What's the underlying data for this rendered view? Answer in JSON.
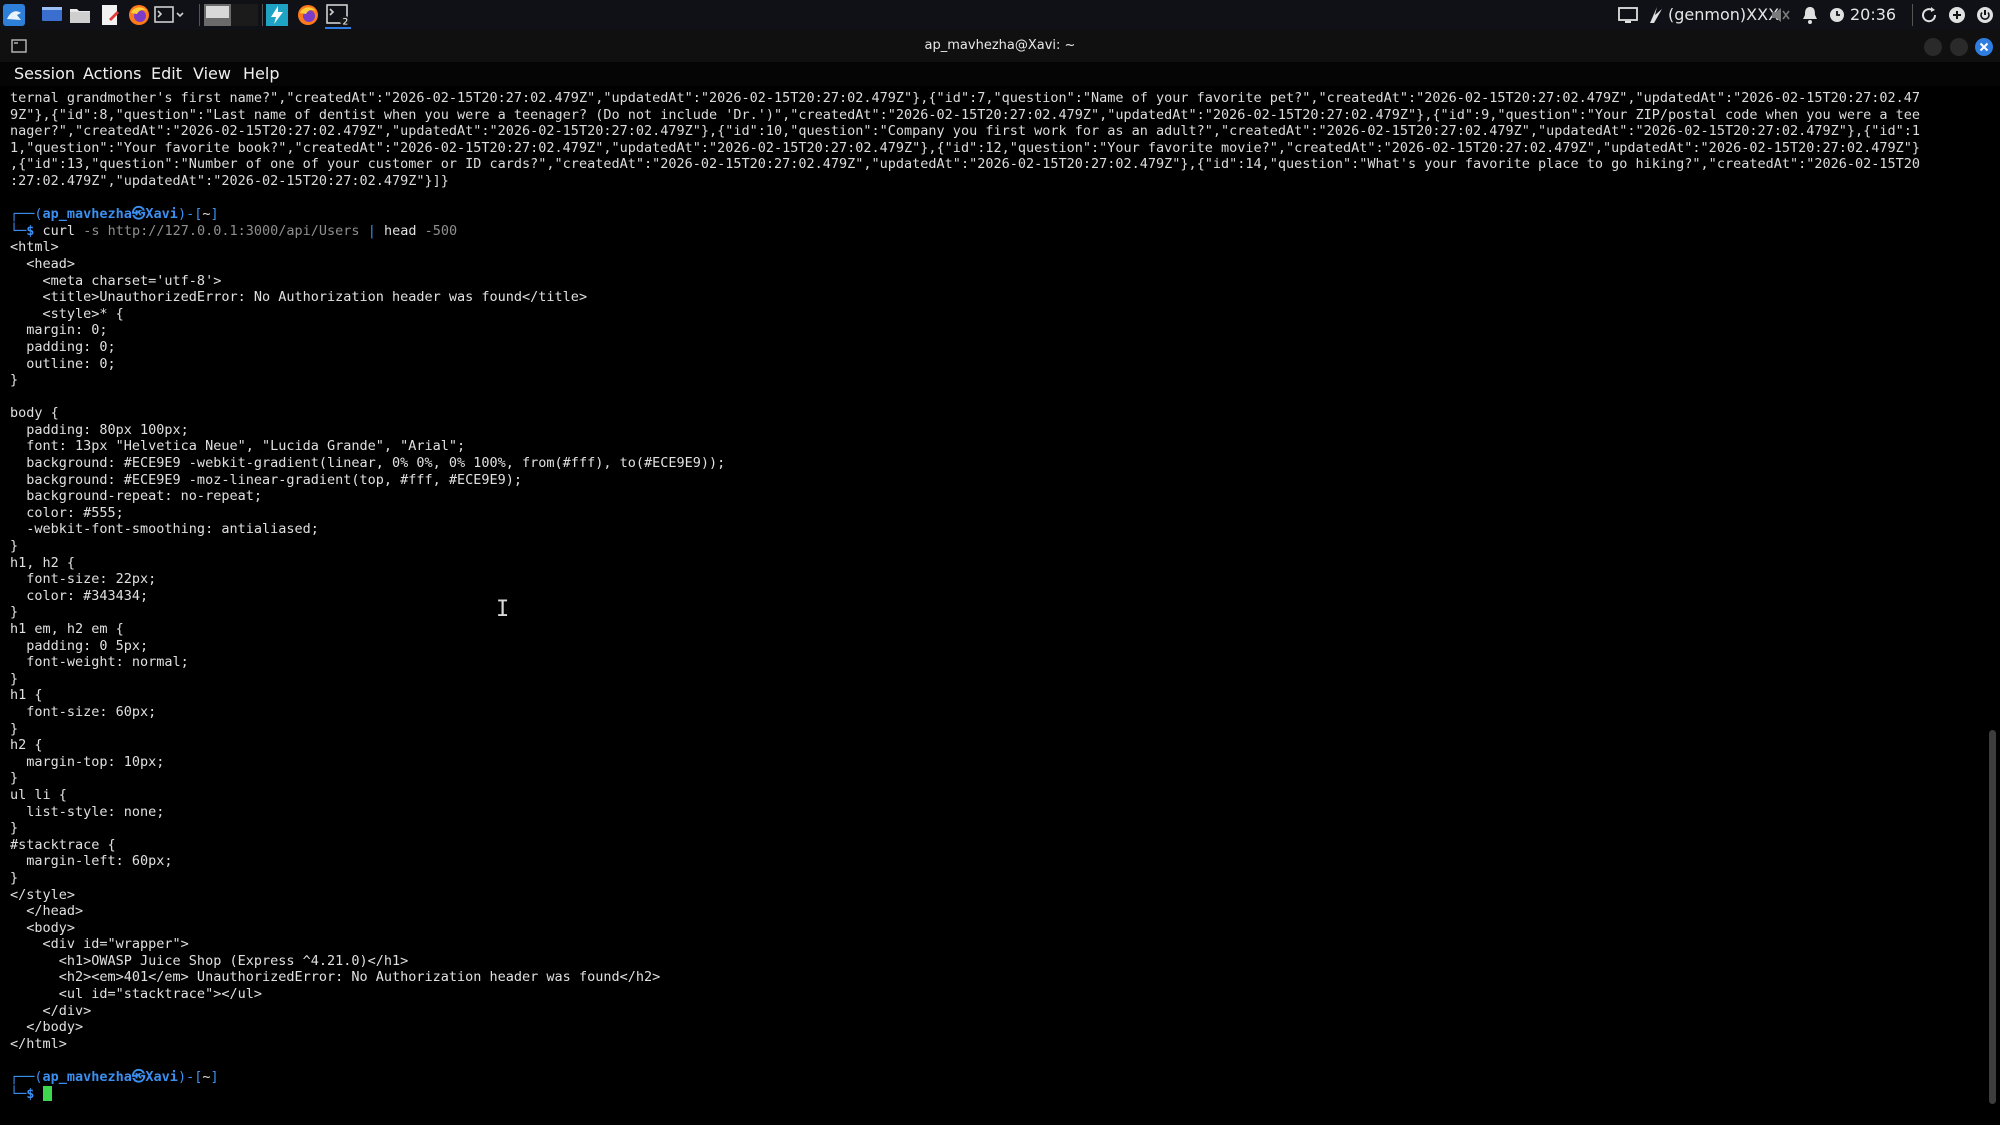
{
  "panel": {
    "tray": {
      "genmon_label": "(genmon)XXX",
      "clock": "20:36"
    }
  },
  "window": {
    "title": "ap_mavhezha@Xavi: ~"
  },
  "menubar": {
    "items": [
      "Session",
      "Actions",
      "Edit",
      "View",
      "Help"
    ]
  },
  "terminal": {
    "scrollbar_position": 0.62,
    "wrapped_output": [
      "ternal grandmother's first name?\",\"createdAt\":\"2026-02-15T20:27:02.479Z\",\"updatedAt\":\"2026-02-15T20:27:02.479Z\"},{\"id\":7,\"question\":\"Name of your favorite pet?\",\"createdAt\":\"2026-02-15T20:27:02.479Z\",\"updatedAt\":\"2026-02-15T20:27:02.47",
      "9Z\"},{\"id\":8,\"question\":\"Last name of dentist when you were a teenager? (Do not include 'Dr.')\",\"createdAt\":\"2026-02-15T20:27:02.479Z\",\"updatedAt\":\"2026-02-15T20:27:02.479Z\"},{\"id\":9,\"question\":\"Your ZIP/postal code when you were a tee",
      "nager?\",\"createdAt\":\"2026-02-15T20:27:02.479Z\",\"updatedAt\":\"2026-02-15T20:27:02.479Z\"},{\"id\":10,\"question\":\"Company you first work for as an adult?\",\"createdAt\":\"2026-02-15T20:27:02.479Z\",\"updatedAt\":\"2026-02-15T20:27:02.479Z\"},{\"id\":1",
      "1,\"question\":\"Your favorite book?\",\"createdAt\":\"2026-02-15T20:27:02.479Z\",\"updatedAt\":\"2026-02-15T20:27:02.479Z\"},{\"id\":12,\"question\":\"Your favorite movie?\",\"createdAt\":\"2026-02-15T20:27:02.479Z\",\"updatedAt\":\"2026-02-15T20:27:02.479Z\"}",
      ",{\"id\":13,\"question\":\"Number of one of your customer or ID cards?\",\"createdAt\":\"2026-02-15T20:27:02.479Z\",\"updatedAt\":\"2026-02-15T20:27:02.479Z\"},{\"id\":14,\"question\":\"What's your favorite place to go hiking?\",\"createdAt\":\"2026-02-15T20",
      ":27:02.479Z\",\"updatedAt\":\"2026-02-15T20:27:02.479Z\"}]}"
    ],
    "prompt": {
      "user_host": "ap_mavhezha㉿Xavi",
      "cwd": "~"
    },
    "command": {
      "bin": "curl",
      "args": "-s http://127.0.0.1:3000/api/Users",
      "pipe": "|",
      "head_cmd": "head",
      "head_arg": "-500"
    },
    "html_output": [
      "<html>",
      "  <head>",
      "    <meta charset='utf-8'>",
      "    <title>UnauthorizedError: No Authorization header was found</title>",
      "    <style>* {",
      "  margin: 0;",
      "  padding: 0;",
      "  outline: 0;",
      "}",
      "",
      "body {",
      "  padding: 80px 100px;",
      "  font: 13px \"Helvetica Neue\", \"Lucida Grande\", \"Arial\";",
      "  background: #ECE9E9 -webkit-gradient(linear, 0% 0%, 0% 100%, from(#fff), to(#ECE9E9));",
      "  background: #ECE9E9 -moz-linear-gradient(top, #fff, #ECE9E9);",
      "  background-repeat: no-repeat;",
      "  color: #555;",
      "  -webkit-font-smoothing: antialiased;",
      "}",
      "h1, h2 {",
      "  font-size: 22px;",
      "  color: #343434;",
      "}",
      "h1 em, h2 em {",
      "  padding: 0 5px;",
      "  font-weight: normal;",
      "}",
      "h1 {",
      "  font-size: 60px;",
      "}",
      "h2 {",
      "  margin-top: 10px;",
      "}",
      "ul li {",
      "  list-style: none;",
      "}",
      "#stacktrace {",
      "  margin-left: 60px;",
      "}",
      "</style>",
      "  </head>",
      "  <body>",
      "    <div id=\"wrapper\">",
      "      <h1>OWASP Juice Shop (Express ^4.21.0)</h1>",
      "      <h2><em>401</em> UnauthorizedError: No Authorization header was found</h2>",
      "      <ul id=\"stacktrace\"></ul>",
      "    </div>",
      "  </body>",
      "</html>"
    ],
    "prompt_symbol": "$"
  },
  "colors": {
    "prompt_blue": "#3b8ff0",
    "cursor_green": "#3dd64f",
    "close_button": "#2f7de1"
  }
}
